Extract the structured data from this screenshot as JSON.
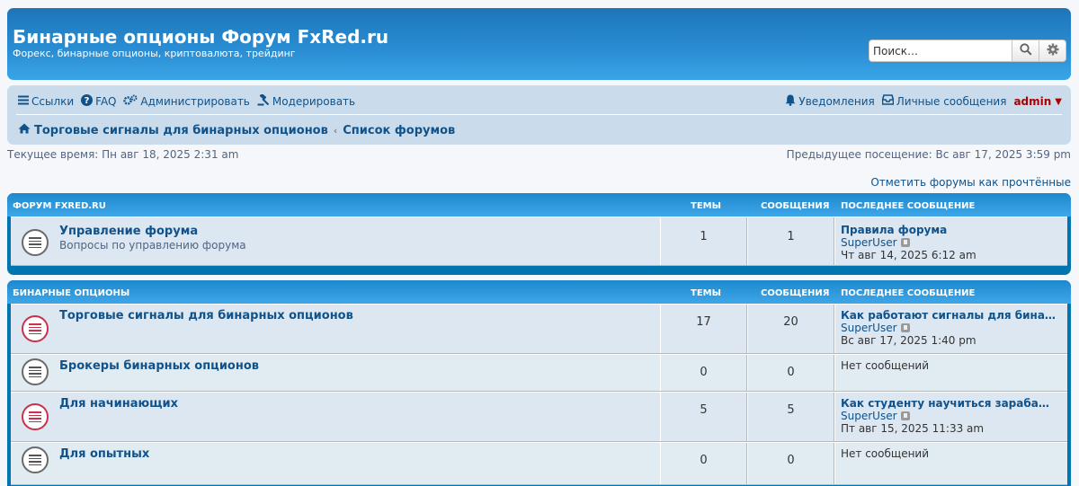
{
  "header": {
    "title": "Бинарные опционы Форум FxRed.ru",
    "description": "Форекс, бинарные опционы, криптовалюта, трейдинг",
    "search_placeholder": "Поиск…"
  },
  "nav": {
    "links": "Ссылки",
    "faq": "FAQ",
    "admin_cp": "Администрировать",
    "moderate": "Модерировать",
    "notifications": "Уведомления",
    "pm": "Личные сообщения",
    "username": "admin"
  },
  "breadcrumb": {
    "item1": "Торговые сигналы для бинарных опционов",
    "item2": "Список форумов"
  },
  "time": {
    "current": "Текущее время: Пн авг 18, 2025 2:31 am",
    "last_visit": "Предыдущее посещение: Вс авг 17, 2025 3:59 pm"
  },
  "mark_read": "Отметить форумы как прочтённые",
  "columns": {
    "topics": "ТЕМЫ",
    "posts": "СООБЩЕНИЯ",
    "last_post": "ПОСЛЕДНЕЕ СООБЩЕНИЕ"
  },
  "categories": [
    {
      "title": "ФОРУМ FXRED.RU",
      "forums": [
        {
          "title": "Управление форума",
          "desc": "Вопросы по управлению форума",
          "topics": "1",
          "posts": "1",
          "last_title": "Правила форума",
          "last_user": "SuperUser",
          "last_date": "Чт авг 14, 2025 6:12 am"
        }
      ]
    },
    {
      "title": "БИНАРНЫЕ ОПЦИОНЫ",
      "forums": [
        {
          "title": "Торговые сигналы для бинарных опционов",
          "topics": "17",
          "posts": "20",
          "last_title": "Как работают сигналы для бина…",
          "last_user": "SuperUser",
          "last_date": "Вс авг 17, 2025 1:40 pm"
        },
        {
          "title": "Брокеры бинарных опционов",
          "topics": "0",
          "posts": "0",
          "last_none": "Нет сообщений"
        },
        {
          "title": "Для начинающих",
          "topics": "5",
          "posts": "5",
          "last_title": "Как студенту научиться зараба…",
          "last_user": "SuperUser",
          "last_date": "Пт авг 15, 2025 11:33 am"
        },
        {
          "title": "Для опытных",
          "topics": "0",
          "posts": "0",
          "last_none": "Нет сообщений"
        }
      ]
    }
  ]
}
